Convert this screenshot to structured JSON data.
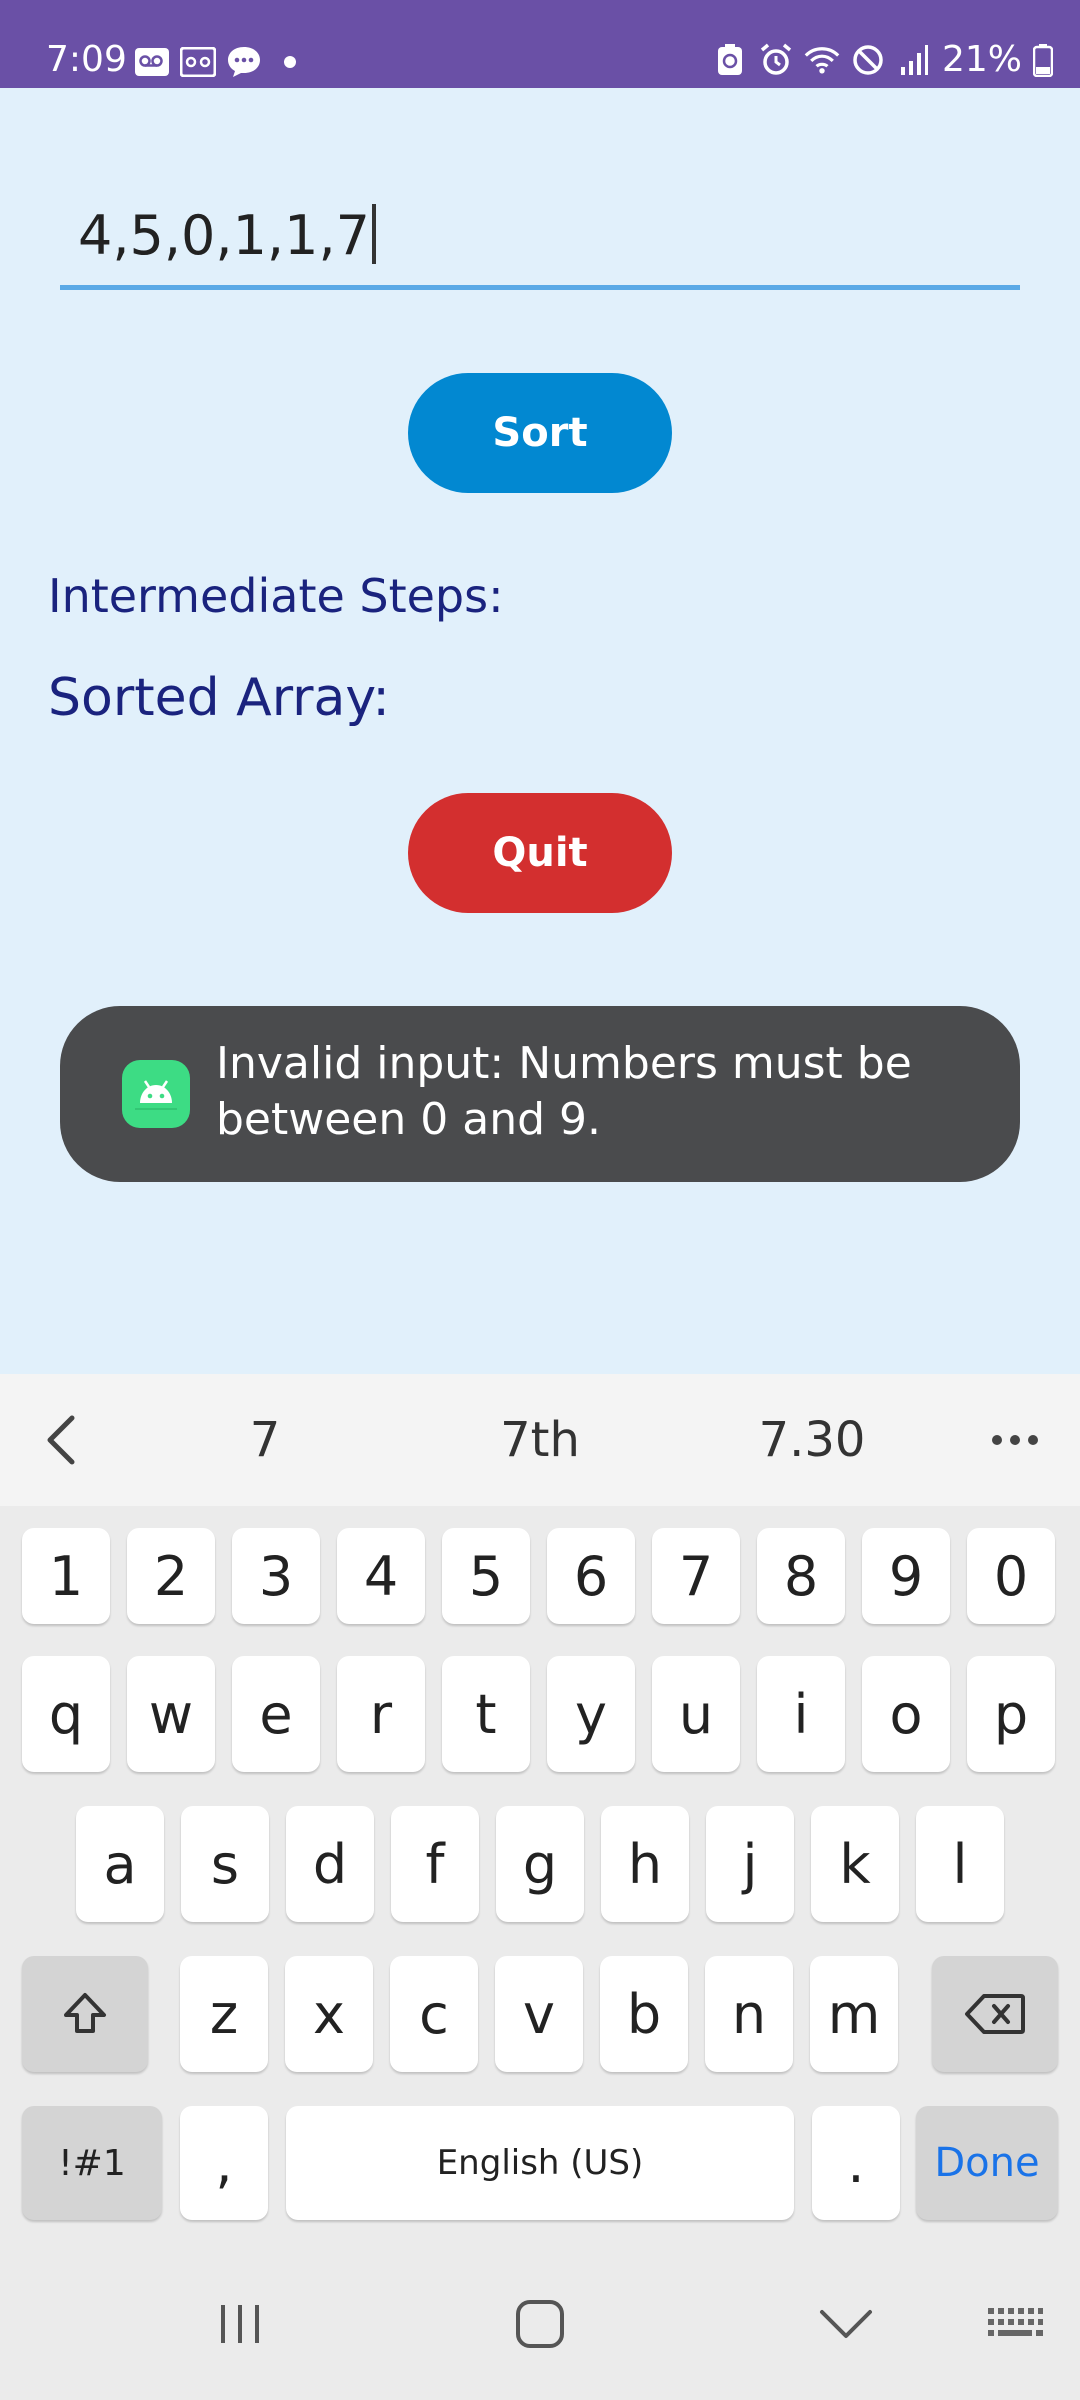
{
  "status_bar": {
    "time": "7:09",
    "battery": "21%",
    "background": "#6a50a6"
  },
  "input": {
    "value": "4,5,0,1,1,7",
    "underline_color": "#5aa9e6"
  },
  "buttons": {
    "sort_label": "Sort",
    "sort_color": "#0288d1",
    "quit_label": "Quit",
    "quit_color": "#d32f2f"
  },
  "labels": {
    "steps": "Intermediate Steps:",
    "sorted": "Sorted Array:"
  },
  "toast": {
    "message": "Invalid input: Numbers must be between 0 and 9.",
    "icon": "android-app-icon"
  },
  "suggestions": {
    "items": [
      "7",
      "7th",
      "7.30"
    ],
    "back_icon": "chevron-left-icon",
    "more_icon": "more-horiz-icon"
  },
  "keyboard": {
    "row_numbers": [
      "1",
      "2",
      "3",
      "4",
      "5",
      "6",
      "7",
      "8",
      "9",
      "0"
    ],
    "row1": [
      "q",
      "w",
      "e",
      "r",
      "t",
      "y",
      "u",
      "i",
      "o",
      "p"
    ],
    "row2": [
      "a",
      "s",
      "d",
      "f",
      "g",
      "h",
      "j",
      "k",
      "l"
    ],
    "row3": [
      "z",
      "x",
      "c",
      "v",
      "b",
      "n",
      "m"
    ],
    "symbols_label": "!#1",
    "comma_label": ",",
    "space_label": "English (US)",
    "period_label": ".",
    "done_label": "Done"
  },
  "nav_bar": {
    "recents_icon": "recents-icon",
    "home_icon": "home-icon",
    "back_icon": "nav-down-chevron-icon",
    "keyboard_icon": "keyboard-icon"
  }
}
